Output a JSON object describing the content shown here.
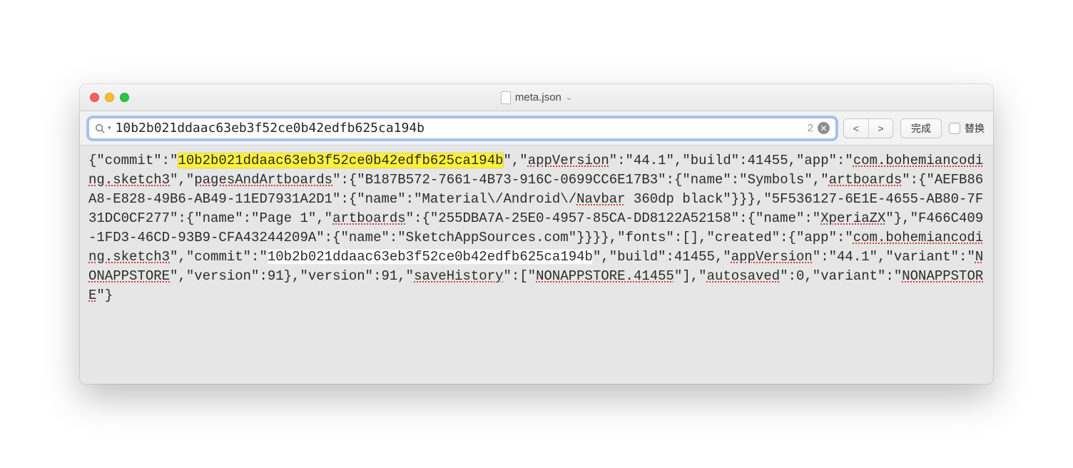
{
  "title": {
    "filename": "meta.json"
  },
  "find": {
    "query": "10b2b021ddaac63eb3f52ce0b42edfb625ca194b",
    "result_count": "2",
    "done_label": "完成",
    "replace_label": "替换"
  },
  "content": {
    "tokens": [
      {
        "t": "{\"commit\":\""
      },
      {
        "t": "10b2b021ddaac63eb3f52ce0b42edfb625ca194b",
        "hl": "yellow"
      },
      {
        "t": "\",\""
      },
      {
        "t": "appVersion",
        "sw": true
      },
      {
        "t": "\":\"44.1\",\"build\":41455,\"app\":\""
      },
      {
        "t": "com.bohemiancoding.sketch3",
        "sw": true
      },
      {
        "t": "\",\""
      },
      {
        "t": "pagesAndArtboards",
        "sw": true
      },
      {
        "t": "\":{\"B187B572-7661-4B73-916C-0699CC6E17B3\":{\"name\":\"Symbols\",\""
      },
      {
        "t": "artboards",
        "sw": true
      },
      {
        "t": "\":{\"AEFB86A8-E828-49B6-AB49-11ED7931A2D1\":{\"name\":\"Material\\/Android\\/"
      },
      {
        "t": "Navbar",
        "sw": true
      },
      {
        "t": " 360dp black\"}}},\"5F536127-6E1E-4655-AB80-7F31DC0CF277\":{\"name\":\"Page 1\",\""
      },
      {
        "t": "artboards",
        "sw": true
      },
      {
        "t": "\":{\"255DBA7A-25E0-4957-85CA-DD8122A52158\":{\"name\":\""
      },
      {
        "t": "XperiaZX",
        "sw": true
      },
      {
        "t": "\"},\"F466C409-1FD3-46CD-93B9-CFA43244209A\":{\"name\":\"SketchAppSources.com\"}}}}"
      },
      {
        "t": ",\"fonts\":[],\"created\":{\"app\":\""
      },
      {
        "t": "com.bohemiancoding.sketch3",
        "sw": true
      },
      {
        "t": "\",\"commit\":\""
      },
      {
        "t": "10b2b021ddaac63eb3f52ce0b42edfb625ca194b",
        "hl": "white"
      },
      {
        "t": "\",\"build\":41455,\""
      },
      {
        "t": "appVersion",
        "sw": true
      },
      {
        "t": "\":\"44.1\",\"variant\":\""
      },
      {
        "t": "NONAPPSTORE",
        "sw": true
      },
      {
        "t": "\",\"version\":91},\"version\":91,\""
      },
      {
        "t": "saveHistory",
        "sw": true
      },
      {
        "t": "\":[\""
      },
      {
        "t": "NONAPPSTORE.41455",
        "sw": true
      },
      {
        "t": "\"],\""
      },
      {
        "t": "autosaved",
        "sw": true
      },
      {
        "t": "\":0,\"variant\":\""
      },
      {
        "t": "NONAPPSTORE",
        "sw": true
      },
      {
        "t": "\"}"
      }
    ]
  }
}
